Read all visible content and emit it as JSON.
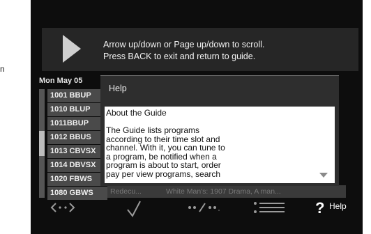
{
  "edge_text": "n",
  "banner": {
    "line1": "Arrow up/down or Page up/down to scroll.",
    "line2": "Press BACK to exit and return to guide."
  },
  "guide": {
    "date": "Mon May 05",
    "channels": [
      "1001 BBUP",
      "1010 BLUP",
      "1011BBUP",
      "1012 BBUS",
      "1013 CBVSX",
      "1014 DBVSX",
      "1020 FBWS",
      "1080 GBWS"
    ],
    "bottom_programs": [
      "Redecu...",
      "White Man's: 1907 Drama, A man..."
    ]
  },
  "popup": {
    "title": "Help",
    "heading": "About the Guide",
    "lines": [
      "The Guide lists programs",
      "according to their time slot and",
      "channel. With it, you can tune to",
      "a program, be notified when a",
      "program is about to start, order",
      "pay per view programs, search"
    ]
  },
  "bottom_bar": {
    "icons": [
      "left-right-arrows-icon",
      "checkmark-icon",
      "page-dots-icon",
      "list-menu-icon",
      "help-icon"
    ],
    "help_symbol": "?",
    "help_label": "Help"
  },
  "colors": {
    "screen_bg": "#0d0d0d",
    "banner_bg": "#262626",
    "popup_bg": "#2e2e2e",
    "channel_bg": "#4a4a4a",
    "icon_gray": "#9a9a9a"
  }
}
